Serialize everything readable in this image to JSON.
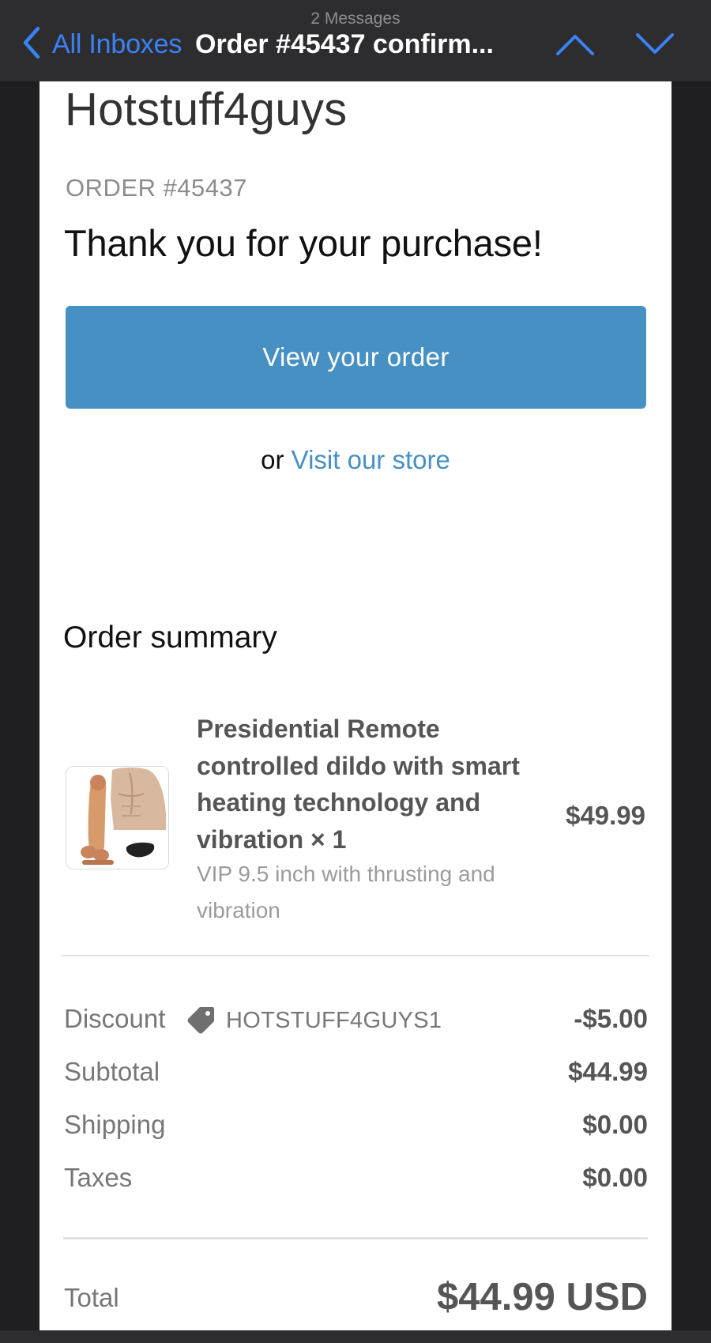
{
  "nav": {
    "message_count": "2 Messages",
    "back_label": "All Inboxes",
    "subject": "Order #45437 confirm..."
  },
  "email": {
    "shop_name": "Hotstuff4guys",
    "order_number": "ORDER #45437",
    "headline": "Thank you for your purchase!",
    "view_order_button": "View your order",
    "store_prefix": "or",
    "store_link": "Visit our store",
    "summary_title": "Order summary",
    "item": {
      "name": "Presidential Remote controlled dildo with smart heating technology and vibration × 1",
      "variant": "VIP 9.5 inch with thrusting and vibration",
      "price": "$49.99"
    },
    "discount": {
      "label": "Discount",
      "code": "HOTSTUFF4GUYS1",
      "value": "-$5.00"
    },
    "subtotal": {
      "label": "Subtotal",
      "value": "$44.99"
    },
    "shipping": {
      "label": "Shipping",
      "value": "$0.00"
    },
    "taxes": {
      "label": "Taxes",
      "value": "$0.00"
    },
    "total": {
      "label": "Total",
      "value": "$44.99 USD"
    }
  },
  "colors": {
    "accent_blue": "#4690c3",
    "ios_link_blue": "#3b82f6",
    "nav_background": "#2d2d2f",
    "page_background": "#1f1f21"
  },
  "icons": [
    "chevron-left-icon",
    "chevron-up-icon",
    "chevron-down-icon",
    "price-tag-icon"
  ]
}
